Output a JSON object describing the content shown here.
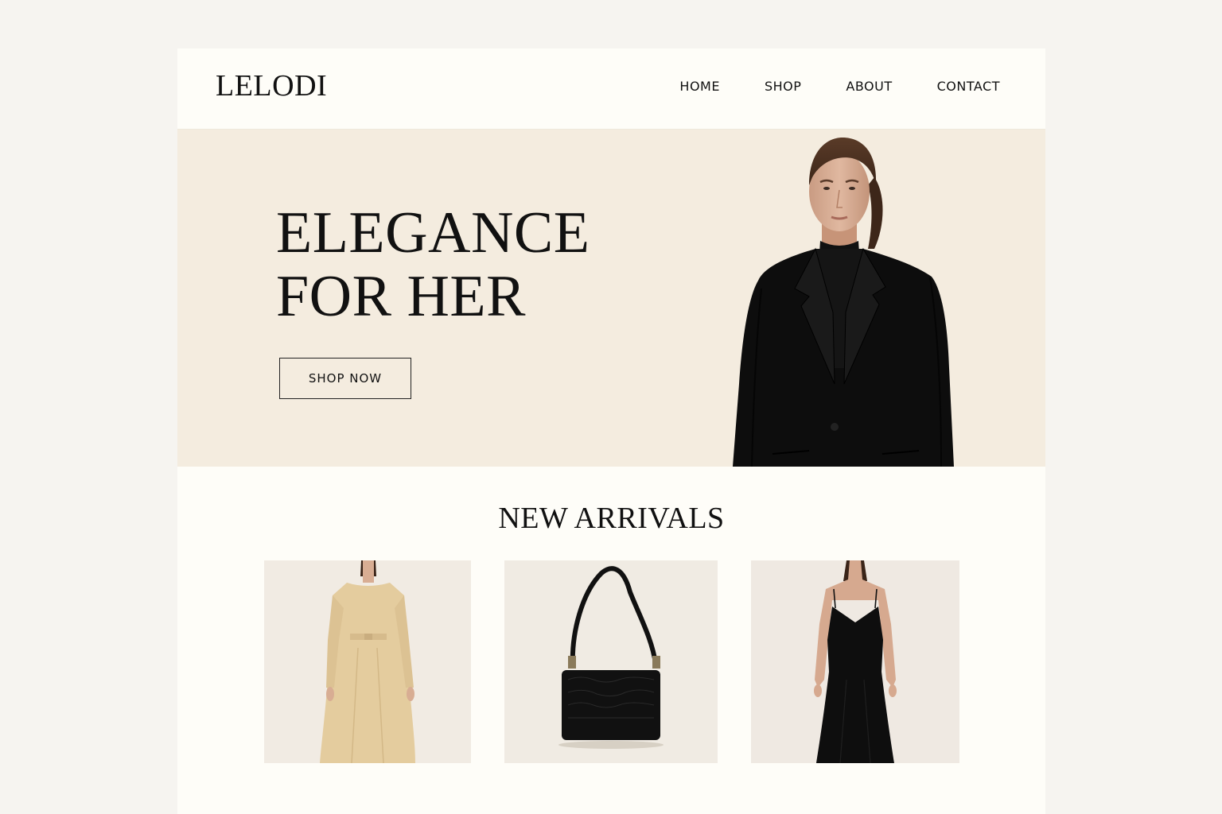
{
  "brand": {
    "name": "LELODI"
  },
  "nav": {
    "items": [
      {
        "label": "HOME"
      },
      {
        "label": "SHOP"
      },
      {
        "label": "ABOUT"
      },
      {
        "label": "CONTACT"
      }
    ]
  },
  "hero": {
    "title_line1": "ELEGANCE",
    "title_line2": "FOR HER",
    "cta_label": "SHOP NOW"
  },
  "new_arrivals": {
    "title": "NEW ARRIVALS",
    "products": [
      {
        "image": "beige-belted-dress"
      },
      {
        "image": "black-shoulder-bag"
      },
      {
        "image": "black-slip-dress"
      }
    ]
  },
  "colors": {
    "page_background": "#f6f4f0",
    "card_background": "#fefdf8",
    "hero_background": "#f4ecdf",
    "text": "#111111"
  }
}
